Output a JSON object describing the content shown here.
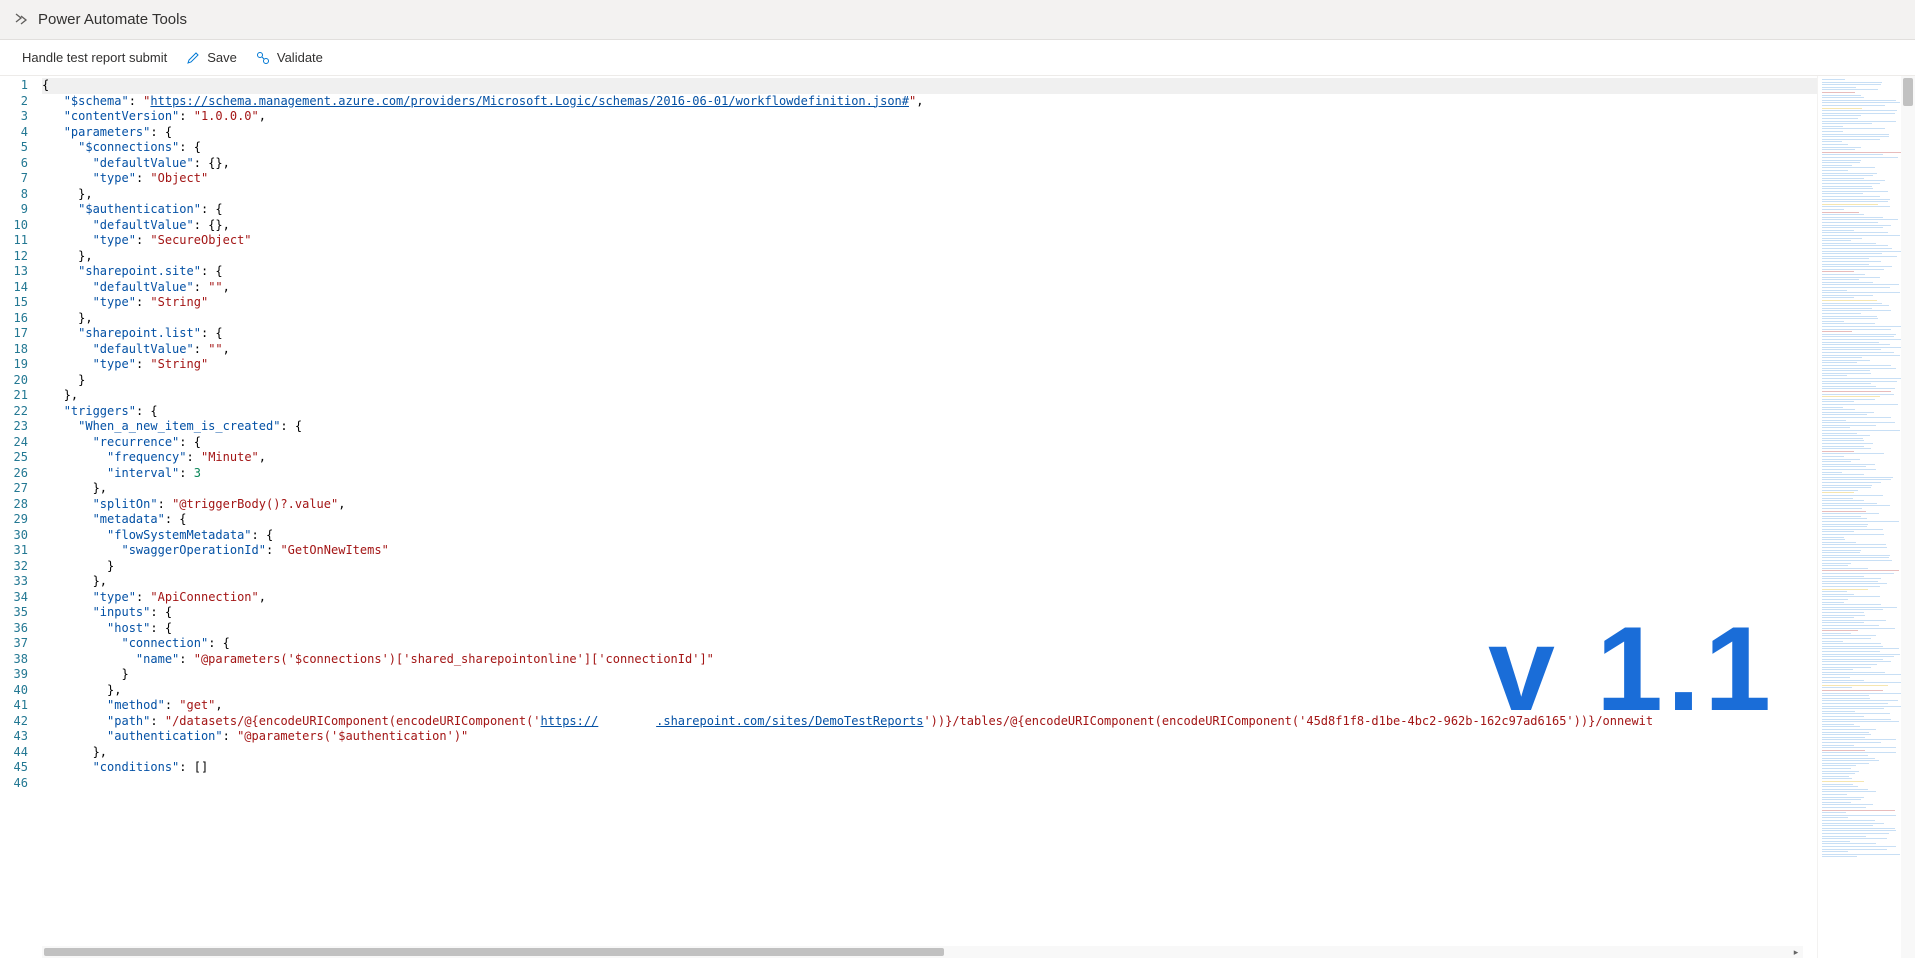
{
  "header": {
    "app_title": "Power Automate Tools"
  },
  "toolbar": {
    "flow_name": "Handle test report submit",
    "save_label": "Save",
    "validate_label": "Validate"
  },
  "overlay": {
    "version_text": "v 1.1"
  },
  "editor": {
    "first_line": 1,
    "last_line": 46,
    "content": {
      "$schema": "https://schema.management.azure.com/providers/Microsoft.Logic/schemas/2016-06-01/workflowdefinition.json#",
      "contentVersion": "1.0.0.0",
      "parameters": {
        "$connections": {
          "defaultValue": {},
          "type": "Object"
        },
        "$authentication": {
          "defaultValue": {},
          "type": "SecureObject"
        },
        "sharepoint.site": {
          "defaultValue": "",
          "type": "String"
        },
        "sharepoint.list": {
          "defaultValue": "",
          "type": "String"
        }
      },
      "triggers": {
        "When_a_new_item_is_created": {
          "recurrence": {
            "frequency": "Minute",
            "interval": 3
          },
          "splitOn": "@triggerBody()?.value",
          "metadata": {
            "flowSystemMetadata": {
              "swaggerOperationId": "GetOnNewItems"
            }
          },
          "type": "ApiConnection",
          "inputs": {
            "host": {
              "connection": {
                "name": "@parameters('$connections')['shared_sharepointonline']['connectionId']"
              }
            },
            "method": "get",
            "path": "/datasets/@{encodeURIComponent(encodeURIComponent('https://        .sharepoint.com/sites/DemoTestReports'))}/tables/@{encodeURIComponent(encodeURIComponent('45d8f1f8-d1be-4bc2-962b-162c97ad6165'))}/onnewit",
            "authentication": "@parameters('$authentication')"
          },
          "conditions": []
        }
      }
    },
    "lines": [
      {
        "n": 1,
        "ind": 0,
        "parts": [
          {
            "t": "{",
            "c": "p"
          }
        ],
        "hl": true
      },
      {
        "n": 2,
        "ind": 1,
        "parts": [
          {
            "t": "\"$schema\"",
            "c": "k"
          },
          {
            "t": ": ",
            "c": "p"
          },
          {
            "t": "\"",
            "c": "s"
          },
          {
            "t": "https://schema.management.azure.com/providers/Microsoft.Logic/schemas/2016-06-01/workflowdefinition.json#",
            "c": "link"
          },
          {
            "t": "\"",
            "c": "s"
          },
          {
            "t": ",",
            "c": "p"
          }
        ]
      },
      {
        "n": 3,
        "ind": 1,
        "parts": [
          {
            "t": "\"contentVersion\"",
            "c": "k"
          },
          {
            "t": ": ",
            "c": "p"
          },
          {
            "t": "\"1.0.0.0\"",
            "c": "s"
          },
          {
            "t": ",",
            "c": "p"
          }
        ]
      },
      {
        "n": 4,
        "ind": 1,
        "parts": [
          {
            "t": "\"parameters\"",
            "c": "k"
          },
          {
            "t": ": {",
            "c": "p"
          }
        ]
      },
      {
        "n": 5,
        "ind": 2,
        "parts": [
          {
            "t": "\"$connections\"",
            "c": "k"
          },
          {
            "t": ": {",
            "c": "p"
          }
        ]
      },
      {
        "n": 6,
        "ind": 3,
        "parts": [
          {
            "t": "\"defaultValue\"",
            "c": "k"
          },
          {
            "t": ": {},",
            "c": "p"
          }
        ]
      },
      {
        "n": 7,
        "ind": 3,
        "parts": [
          {
            "t": "\"type\"",
            "c": "k"
          },
          {
            "t": ": ",
            "c": "p"
          },
          {
            "t": "\"Object\"",
            "c": "s"
          }
        ]
      },
      {
        "n": 8,
        "ind": 2,
        "parts": [
          {
            "t": "},",
            "c": "p"
          }
        ]
      },
      {
        "n": 9,
        "ind": 2,
        "parts": [
          {
            "t": "\"$authentication\"",
            "c": "k"
          },
          {
            "t": ": {",
            "c": "p"
          }
        ]
      },
      {
        "n": 10,
        "ind": 3,
        "parts": [
          {
            "t": "\"defaultValue\"",
            "c": "k"
          },
          {
            "t": ": {},",
            "c": "p"
          }
        ]
      },
      {
        "n": 11,
        "ind": 3,
        "parts": [
          {
            "t": "\"type\"",
            "c": "k"
          },
          {
            "t": ": ",
            "c": "p"
          },
          {
            "t": "\"SecureObject\"",
            "c": "s"
          }
        ]
      },
      {
        "n": 12,
        "ind": 2,
        "parts": [
          {
            "t": "},",
            "c": "p"
          }
        ]
      },
      {
        "n": 13,
        "ind": 2,
        "parts": [
          {
            "t": "\"sharepoint.site\"",
            "c": "k"
          },
          {
            "t": ": {",
            "c": "p"
          }
        ]
      },
      {
        "n": 14,
        "ind": 3,
        "parts": [
          {
            "t": "\"defaultValue\"",
            "c": "k"
          },
          {
            "t": ": ",
            "c": "p"
          },
          {
            "t": "\"\"",
            "c": "s"
          },
          {
            "t": ",",
            "c": "p"
          }
        ]
      },
      {
        "n": 15,
        "ind": 3,
        "parts": [
          {
            "t": "\"type\"",
            "c": "k"
          },
          {
            "t": ": ",
            "c": "p"
          },
          {
            "t": "\"String\"",
            "c": "s"
          }
        ]
      },
      {
        "n": 16,
        "ind": 2,
        "parts": [
          {
            "t": "},",
            "c": "p"
          }
        ]
      },
      {
        "n": 17,
        "ind": 2,
        "parts": [
          {
            "t": "\"sharepoint.list\"",
            "c": "k"
          },
          {
            "t": ": {",
            "c": "p"
          }
        ]
      },
      {
        "n": 18,
        "ind": 3,
        "parts": [
          {
            "t": "\"defaultValue\"",
            "c": "k"
          },
          {
            "t": ": ",
            "c": "p"
          },
          {
            "t": "\"\"",
            "c": "s"
          },
          {
            "t": ",",
            "c": "p"
          }
        ]
      },
      {
        "n": 19,
        "ind": 3,
        "parts": [
          {
            "t": "\"type\"",
            "c": "k"
          },
          {
            "t": ": ",
            "c": "p"
          },
          {
            "t": "\"String\"",
            "c": "s"
          }
        ]
      },
      {
        "n": 20,
        "ind": 2,
        "parts": [
          {
            "t": "}",
            "c": "p"
          }
        ]
      },
      {
        "n": 21,
        "ind": 1,
        "parts": [
          {
            "t": "},",
            "c": "p"
          }
        ]
      },
      {
        "n": 22,
        "ind": 1,
        "parts": [
          {
            "t": "\"triggers\"",
            "c": "k"
          },
          {
            "t": ": {",
            "c": "p"
          }
        ]
      },
      {
        "n": 23,
        "ind": 2,
        "parts": [
          {
            "t": "\"When_a_new_item_is_created\"",
            "c": "k"
          },
          {
            "t": ": {",
            "c": "p"
          }
        ]
      },
      {
        "n": 24,
        "ind": 3,
        "parts": [
          {
            "t": "\"recurrence\"",
            "c": "k"
          },
          {
            "t": ": {",
            "c": "p"
          }
        ]
      },
      {
        "n": 25,
        "ind": 4,
        "parts": [
          {
            "t": "\"frequency\"",
            "c": "k"
          },
          {
            "t": ": ",
            "c": "p"
          },
          {
            "t": "\"Minute\"",
            "c": "s"
          },
          {
            "t": ",",
            "c": "p"
          }
        ]
      },
      {
        "n": 26,
        "ind": 4,
        "parts": [
          {
            "t": "\"interval\"",
            "c": "k"
          },
          {
            "t": ": ",
            "c": "p"
          },
          {
            "t": "3",
            "c": "n"
          }
        ]
      },
      {
        "n": 27,
        "ind": 3,
        "parts": [
          {
            "t": "},",
            "c": "p"
          }
        ]
      },
      {
        "n": 28,
        "ind": 3,
        "parts": [
          {
            "t": "\"splitOn\"",
            "c": "k"
          },
          {
            "t": ": ",
            "c": "p"
          },
          {
            "t": "\"@triggerBody()?.value\"",
            "c": "s"
          },
          {
            "t": ",",
            "c": "p"
          }
        ]
      },
      {
        "n": 29,
        "ind": 3,
        "parts": [
          {
            "t": "\"metadata\"",
            "c": "k"
          },
          {
            "t": ": {",
            "c": "p"
          }
        ]
      },
      {
        "n": 30,
        "ind": 4,
        "parts": [
          {
            "t": "\"flowSystemMetadata\"",
            "c": "k"
          },
          {
            "t": ": {",
            "c": "p"
          }
        ]
      },
      {
        "n": 31,
        "ind": 5,
        "parts": [
          {
            "t": "\"swaggerOperationId\"",
            "c": "k"
          },
          {
            "t": ": ",
            "c": "p"
          },
          {
            "t": "\"GetOnNewItems\"",
            "c": "s"
          }
        ]
      },
      {
        "n": 32,
        "ind": 4,
        "parts": [
          {
            "t": "}",
            "c": "p"
          }
        ]
      },
      {
        "n": 33,
        "ind": 3,
        "parts": [
          {
            "t": "},",
            "c": "p"
          }
        ]
      },
      {
        "n": 34,
        "ind": 3,
        "parts": [
          {
            "t": "\"type\"",
            "c": "k"
          },
          {
            "t": ": ",
            "c": "p"
          },
          {
            "t": "\"ApiConnection\"",
            "c": "s"
          },
          {
            "t": ",",
            "c": "p"
          }
        ]
      },
      {
        "n": 35,
        "ind": 3,
        "parts": [
          {
            "t": "\"inputs\"",
            "c": "k"
          },
          {
            "t": ": {",
            "c": "p"
          }
        ]
      },
      {
        "n": 36,
        "ind": 4,
        "parts": [
          {
            "t": "\"host\"",
            "c": "k"
          },
          {
            "t": ": {",
            "c": "p"
          }
        ]
      },
      {
        "n": 37,
        "ind": 5,
        "parts": [
          {
            "t": "\"connection\"",
            "c": "k"
          },
          {
            "t": ": {",
            "c": "p"
          }
        ]
      },
      {
        "n": 38,
        "ind": 6,
        "parts": [
          {
            "t": "\"name\"",
            "c": "k"
          },
          {
            "t": ": ",
            "c": "p"
          },
          {
            "t": "\"@parameters('$connections')['shared_sharepointonline']['connectionId']\"",
            "c": "s"
          }
        ]
      },
      {
        "n": 39,
        "ind": 5,
        "parts": [
          {
            "t": "}",
            "c": "p"
          }
        ]
      },
      {
        "n": 40,
        "ind": 4,
        "parts": [
          {
            "t": "},",
            "c": "p"
          }
        ]
      },
      {
        "n": 41,
        "ind": 4,
        "parts": [
          {
            "t": "\"method\"",
            "c": "k"
          },
          {
            "t": ": ",
            "c": "p"
          },
          {
            "t": "\"get\"",
            "c": "s"
          },
          {
            "t": ",",
            "c": "p"
          }
        ]
      },
      {
        "n": 42,
        "ind": 4,
        "parts": [
          {
            "t": "\"path\"",
            "c": "k"
          },
          {
            "t": ": ",
            "c": "p"
          },
          {
            "t": "\"/datasets/@{encodeURIComponent(encodeURIComponent('",
            "c": "s"
          },
          {
            "t": "https://",
            "c": "link"
          },
          {
            "t": "        ",
            "c": "s"
          },
          {
            "t": ".sharepoint.com/sites/DemoTestReports",
            "c": "link"
          },
          {
            "t": "'))}/tables/@{encodeURIComponent(encodeURIComponent('45d8f1f8-d1be-4bc2-962b-162c97ad6165'))}/onnewit",
            "c": "s"
          }
        ]
      },
      {
        "n": 43,
        "ind": 4,
        "parts": [
          {
            "t": "\"authentication\"",
            "c": "k"
          },
          {
            "t": ": ",
            "c": "p"
          },
          {
            "t": "\"@parameters('$authentication')\"",
            "c": "s"
          }
        ]
      },
      {
        "n": 44,
        "ind": 3,
        "parts": [
          {
            "t": "},",
            "c": "p"
          }
        ]
      },
      {
        "n": 45,
        "ind": 3,
        "parts": [
          {
            "t": "\"conditions\"",
            "c": "k"
          },
          {
            "t": ": []",
            "c": "p"
          }
        ]
      },
      {
        "n": 46,
        "ind": 2,
        "parts": []
      }
    ]
  }
}
